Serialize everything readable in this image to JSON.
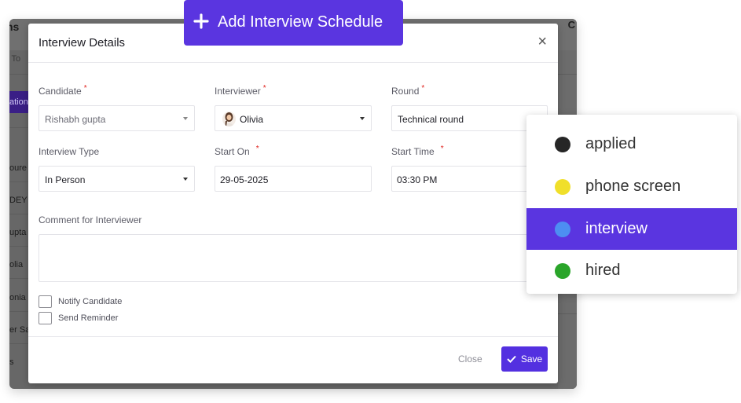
{
  "banner": {
    "label": "Add Interview Schedule"
  },
  "background": {
    "title_fragment": "ns",
    "top_right_fragment": "C",
    "search_fragment": "ce To",
    "tab_fragment": "ation",
    "list_fragments": [
      "oure",
      "DEY",
      "upta",
      "olia",
      "onia",
      "er Sa",
      "s"
    ]
  },
  "modal": {
    "title": "Interview Details",
    "close_symbol": "×",
    "fields": {
      "candidate": {
        "label": "Candidate",
        "value": "Rishabh gupta"
      },
      "interviewer": {
        "label": "Interviewer",
        "value": "Olivia"
      },
      "round": {
        "label": "Round",
        "value": "Technical round"
      },
      "interview_type": {
        "label": "Interview Type",
        "value": "In Person"
      },
      "start_on": {
        "label": "Start On",
        "value": "29-05-2025"
      },
      "start_time": {
        "label": "Start Time",
        "value": "03:30 PM"
      },
      "comment": {
        "label": "Comment for Interviewer",
        "value": ""
      }
    },
    "required_mark": "*",
    "checkboxes": [
      {
        "label": "Notify Candidate",
        "checked": false
      },
      {
        "label": "Send Reminder",
        "checked": false
      }
    ],
    "footer": {
      "close_label": "Close",
      "save_label": "Save"
    }
  },
  "status_dropdown": {
    "items": [
      {
        "label": "applied",
        "color": "#262626",
        "active": false
      },
      {
        "label": "phone screen",
        "color": "#f0df2a",
        "active": false
      },
      {
        "label": "interview",
        "color": "#4d8ef2",
        "active": true
      },
      {
        "label": "hired",
        "color": "#2aa52a",
        "active": false
      }
    ]
  },
  "colors": {
    "accent": "#5a35e0",
    "required": "#e0221d"
  }
}
